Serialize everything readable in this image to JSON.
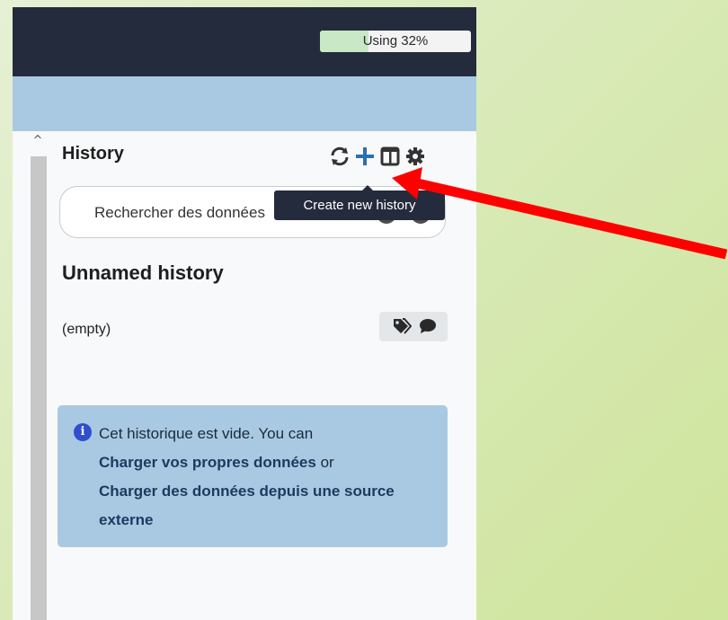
{
  "header": {
    "quota_label": "Using 32%",
    "quota_percent": 32
  },
  "history_panel": {
    "title": "History",
    "icons": [
      "refresh-icon",
      "plus-icon",
      "columns-icon",
      "gear-icon"
    ],
    "search_placeholder": "Rechercher des données",
    "tooltip": "Create new history",
    "history_name": "Unnamed history",
    "status": "(empty)",
    "tag_icons": [
      "tags-icon",
      "comment-icon"
    ]
  },
  "empty_alert": {
    "text_before": "Cet historique est vide. You can",
    "link_upload": "Charger vos propres données",
    "text_or": "or",
    "link_external": "Charger des données depuis une source externe"
  },
  "colors": {
    "topbar": "#242b3c",
    "bluebar": "#a9c9e3",
    "accent_plus": "#2c6fb0",
    "annotation_arrow": "#ff0000"
  }
}
